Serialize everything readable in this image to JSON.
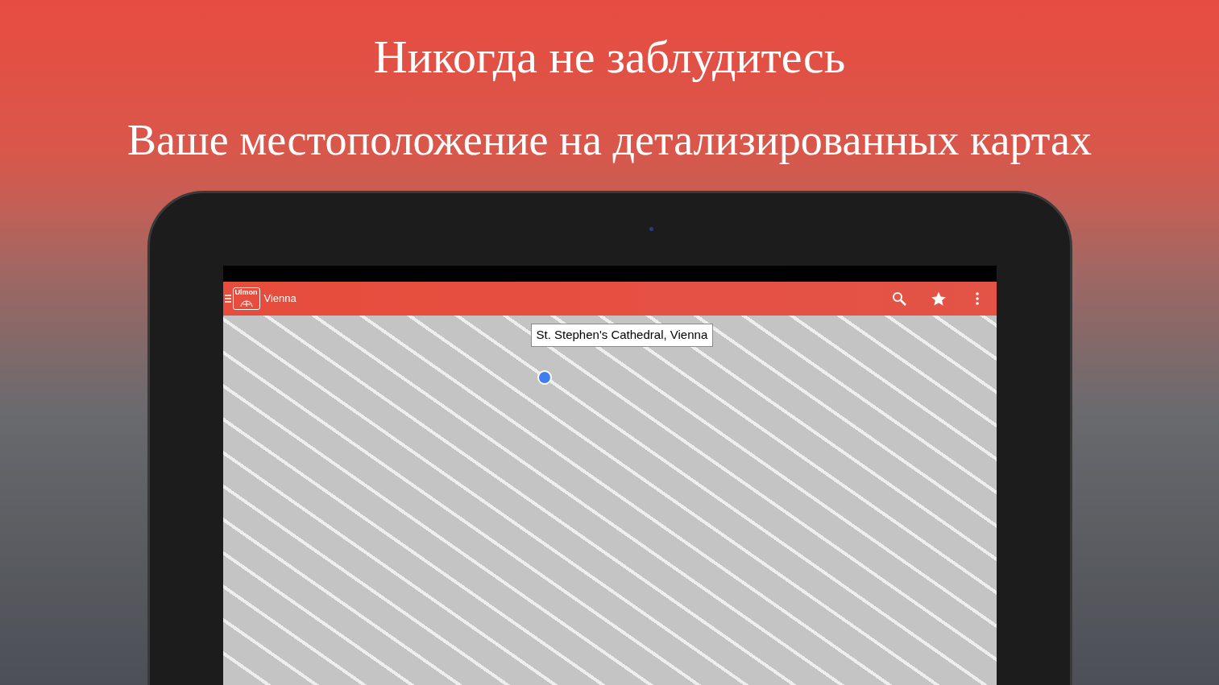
{
  "headline": "Никогда не заблудитесь",
  "subheadline": "Ваше местоположение на детализированных картах",
  "app": {
    "logo_text": "Ulmon",
    "title": "Vienna",
    "map_popup": "St. Stephen's Cathedral, Vienna"
  }
}
